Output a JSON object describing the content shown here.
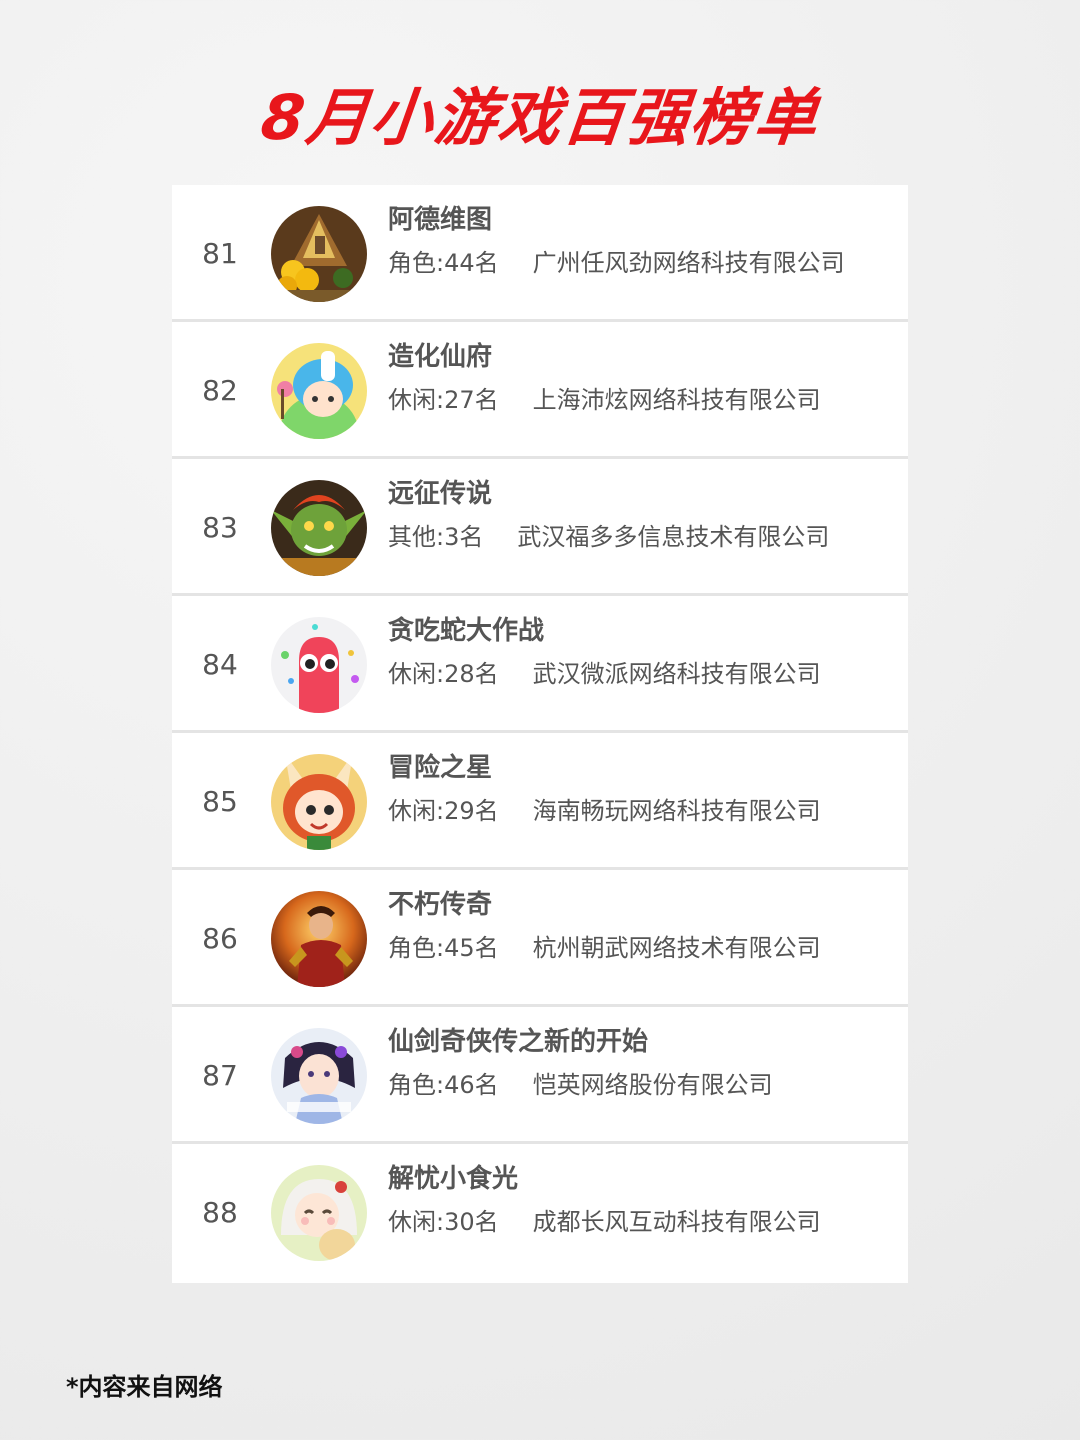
{
  "title": "8月小游戏百强榜单",
  "footer": "*内容来自网络",
  "games": [
    {
      "rank": "81",
      "name": "阿德维图",
      "category": "角色:44名",
      "company": "广州任风劲网络科技有限公司",
      "icon": "gold-mine-game-icon"
    },
    {
      "rank": "82",
      "name": "造化仙府",
      "category": "休闲:27名",
      "company": "上海沛炫网络科技有限公司",
      "icon": "blue-hair-girl-game-icon"
    },
    {
      "rank": "83",
      "name": "远征传说",
      "category": "其他:3名",
      "company": "武汉福多多信息技术有限公司",
      "icon": "goblin-game-icon"
    },
    {
      "rank": "84",
      "name": "贪吃蛇大作战",
      "category": "休闲:28名",
      "company": "武汉微派网络科技有限公司",
      "icon": "red-snake-game-icon"
    },
    {
      "rank": "85",
      "name": "冒险之星",
      "category": "休闲:29名",
      "company": "海南畅玩网络科技有限公司",
      "icon": "bunny-hood-hero-game-icon"
    },
    {
      "rank": "86",
      "name": "不朽传奇",
      "category": "角色:45名",
      "company": "杭州朝武网络技术有限公司",
      "icon": "warrior-game-icon"
    },
    {
      "rank": "87",
      "name": "仙剑奇侠传之新的开始",
      "category": "角色:46名",
      "company": "恺英网络股份有限公司",
      "icon": "xianjian-game-icon"
    },
    {
      "rank": "88",
      "name": "解忧小食光",
      "category": "休闲:30名",
      "company": "成都长风互动科技有限公司",
      "icon": "anime-girl-game-icon"
    }
  ]
}
